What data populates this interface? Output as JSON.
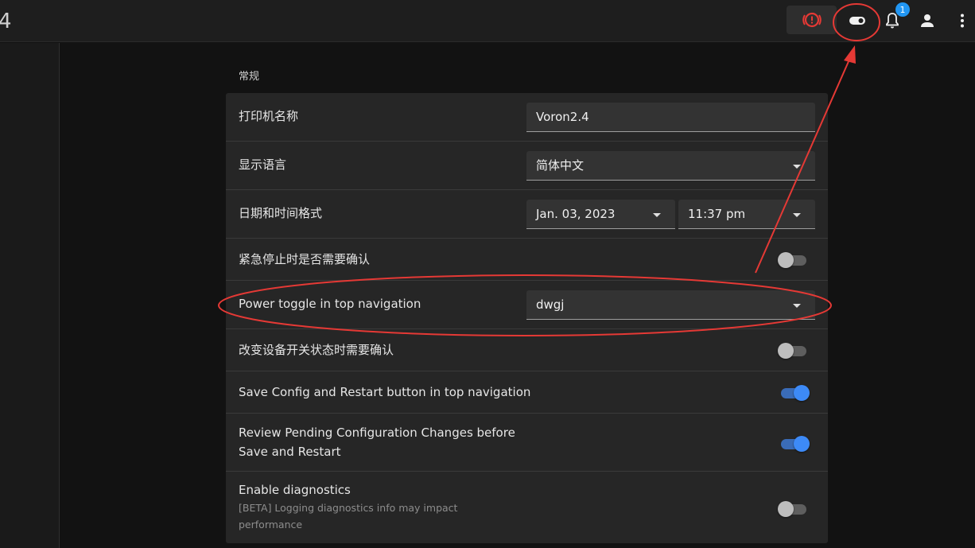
{
  "topbar": {
    "title_fragment": "4",
    "notifications_count": "1",
    "icons": [
      "emergency-stop-icon",
      "power-toggle-icon",
      "bell-icon",
      "account-icon",
      "more-vert-icon"
    ]
  },
  "section": {
    "title": "常规"
  },
  "settings": {
    "printer_name": {
      "label": "打印机名称",
      "value": "Voron2.4"
    },
    "language": {
      "label": "显示语言",
      "value": "简体中文"
    },
    "datetime": {
      "label": "日期和时间格式",
      "date_value": "Jan. 03, 2023",
      "time_value": "11:37 pm"
    },
    "estop_confirm": {
      "label": "紧急停止时是否需要确认",
      "enabled": false
    },
    "power_toggle": {
      "label": "Power toggle in top navigation",
      "value": "dwgj"
    },
    "device_confirm": {
      "label": "改变设备开关状态时需要确认",
      "enabled": false
    },
    "save_config": {
      "label": "Save Config and Restart button in top navigation",
      "enabled": true
    },
    "review_pending": {
      "label_line1": "Review Pending Configuration Changes before",
      "label_line2": "Save and Restart",
      "enabled": true
    },
    "diagnostics": {
      "label": "Enable diagnostics",
      "sub_line1": "[BETA] Logging diagnostics info may impact",
      "sub_line2": "performance",
      "enabled": false
    }
  },
  "colors": {
    "accent": "#3d8af7",
    "annotation": "#e53935",
    "estop": "#e53935",
    "badge": "#2196f3"
  }
}
